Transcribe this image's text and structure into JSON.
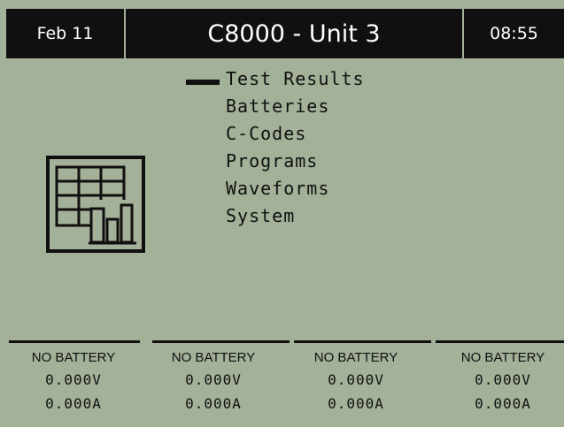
{
  "header": {
    "date": "Feb 11",
    "title": "C8000 - Unit 3",
    "time": "08:55"
  },
  "menu": {
    "selected_index": 0,
    "icon": "test-results-icon",
    "items": [
      "Test Results",
      "Batteries",
      "C-Codes",
      "Programs",
      "Waveforms",
      "System"
    ]
  },
  "channels": [
    {
      "status": "NO BATTERY",
      "voltage": "0.000V",
      "current": "0.000A"
    },
    {
      "status": "NO BATTERY",
      "voltage": "0.000V",
      "current": "0.000A"
    },
    {
      "status": "NO BATTERY",
      "voltage": "0.000V",
      "current": "0.000A"
    },
    {
      "status": "NO BATTERY",
      "voltage": "0.000V",
      "current": "0.000A"
    }
  ],
  "colors": {
    "screen_background": "#a3b198",
    "ink": "#101010",
    "header_text": "#ffffff"
  }
}
